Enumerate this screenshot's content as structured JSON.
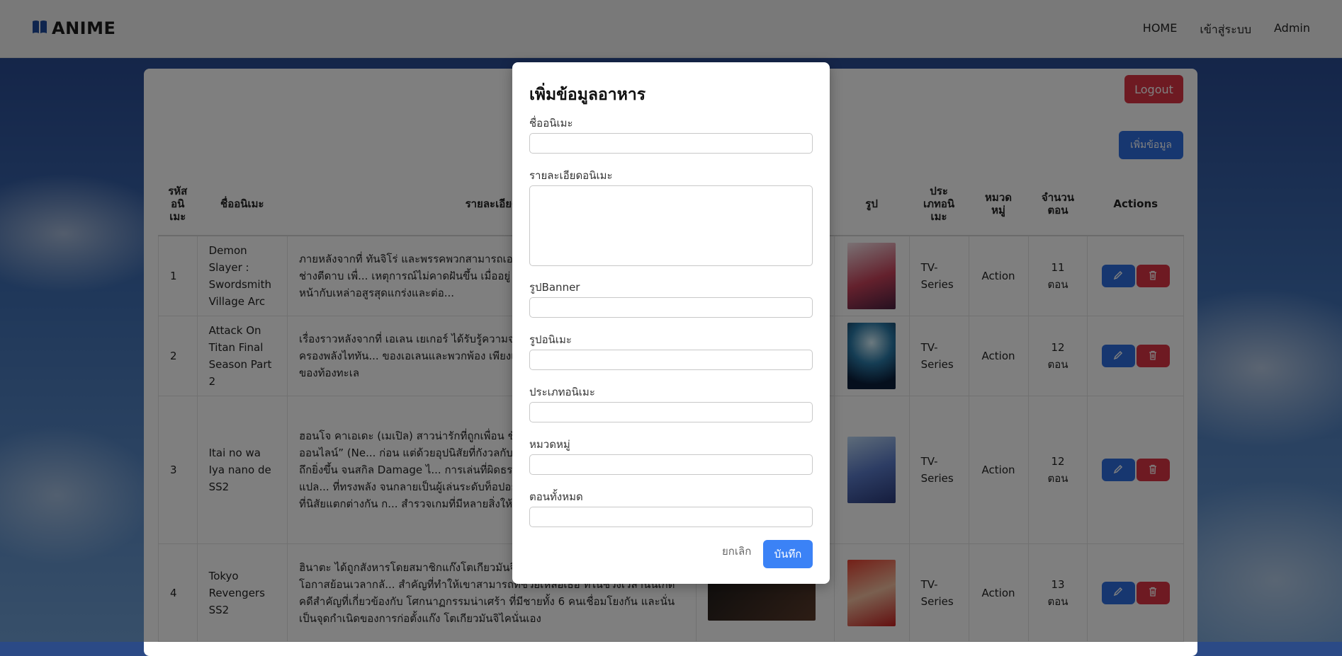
{
  "nav": {
    "brand": "ANIME",
    "brand_icon": "book-icon",
    "links": [
      "HOME",
      "เข้าสู่ระบบ",
      "Admin"
    ]
  },
  "panel": {
    "logout_label": "Logout",
    "add_label": "เพิ่มข้อมูล"
  },
  "table": {
    "headers": [
      "รหัสอนิเมะ",
      "ชื่ออนิเมะ",
      "รายละเอียด",
      "รูป",
      "ประเภทอนิเมะ",
      "หมวดหมู่",
      "จำนวนตอน",
      "Actions"
    ],
    "header_lines": {
      "id": [
        "รหัส",
        "อนิ",
        "เมะ"
      ],
      "type": [
        "ประ",
        "เภทอนิ",
        "เมะ"
      ],
      "category": [
        "หมวด",
        "หมู่"
      ],
      "episodes": [
        "จำนวน",
        "ตอน"
      ]
    },
    "rows": [
      {
        "id": "1",
        "name": "Demon Slayer : Swordsmith Village Arc",
        "desc": "ภายหลังจากที่ ทันจิโร่ และพรรคพวกสามารถเอ... รับภารกิจให้เดินทางไปยังหมู่บ้านช่างตีดาบ เพื่... เหตุการณ์ไม่คาดฝันขึ้น เมื่ออยู่ ๆ ก็มีอสูรปริศน... จึงต้องเข้าเผชิญหน้ากับเหล่าอสูรสุดแกร่งและต่อ...",
        "type": "TV-Series",
        "category": "Action",
        "episodes": "11 ตอน"
      },
      {
        "id": "2",
        "name": "Attack On Titan Final Season Part 2",
        "desc": "เรื่องราวหลังจากที่ เอเลน เยเกอร์ ได้รับรู้ความจ... รวมถึงเรื่องราวของราชวงศ์ที่ถือครองพลังไททัน... ของเอเลนและพวกพ้อง เพียงแต่ครั้งนี้จะไม่ใช่ก... ที่อยู่อีกฟากฝั่งของท้องทะเล",
        "type": "TV-Series",
        "category": "Action",
        "episodes": "12 ตอน"
      },
      {
        "id": "3",
        "name": "Itai no wa Iya nano de SS2",
        "desc": "ฮอนโจ คาเอเดะ (เมเปิล) สาวน่ารักที่ถูกเพื่อน ชั... เสมือนจริง VRMMO “นิวเวิร์ลด์ออนไลน์” (Ne... ก่อน แต่ด้วยอุปนิสัยที่กังวลกับการโดนโจมตี ไม... ค่า VIT เพื่อให้ถึกยิ่งขึ้น จนสกิล Damage ไ... การเล่นที่ผิดธรรมดากว่าคนทั่วไป ทำให้ได้สกิลแปล... ที่ทรงพลัง จนกลายเป็นผู้เล่นระดับท็อปอย่างรวด... ผู้ดูแลเกม เธอยังได้เพื่อนฝูงที่นิสัยแตกต่างกัน ก... สำรวจเกมที่มีหลายสิ่งให้ค้นหา",
        "type": "TV-Series",
        "category": "Action",
        "episodes": "12 ตอน"
      },
      {
        "id": "4",
        "name": "Tokyo Revengers SS2",
        "desc": "ฮินาตะ ได้ถูกสังหารโดยสมาชิกแก๊งโตเกียวมันจิ... เกะมิจิ และนั่นทำให้เขาได้มีโอกาสย้อนเวลากลั... สำคัญที่ทำให้เขาสามารถที่ช่วยเหลือเธอ ที่ในช่วงเวลานั้นเกิดคดีสำคัญที่เกี่ยวข้องกับ โศกนาฏกรรมน่าเศร้า ที่มีชายทั้ง 6 คนเชื่อมโยงกัน และนั่นเป็นจุดกำเนิดของการก่อตั้งแก๊ง โตเกียวมันจิไคนั่นเอง",
        "type": "TV-Series",
        "category": "Action",
        "episodes": "13 ตอน"
      }
    ]
  },
  "modal": {
    "title": "เพิ่มข้อมูลอาหาร",
    "fields": [
      {
        "label": "ชื่ออนิเมะ",
        "value": "",
        "placeholder": ""
      },
      {
        "label": "รายละเอียดอนิเมะ",
        "value": "",
        "placeholder": ""
      },
      {
        "label": "รูปBanner",
        "value": "",
        "placeholder": ""
      },
      {
        "label": "รูปอนิเมะ",
        "value": "",
        "placeholder": ""
      },
      {
        "label": "ประเภทอนิเมะ",
        "value": "",
        "placeholder": ""
      },
      {
        "label": "หมวดหมู่",
        "value": "",
        "placeholder": ""
      },
      {
        "label": "ตอนทั้งหมด",
        "value": "",
        "placeholder": ""
      }
    ],
    "cancel_label": "ยกเลิก",
    "save_label": "บันทึก"
  },
  "colors": {
    "primary": "#2f6fe0",
    "danger": "#dc3545",
    "save": "#3b82f6"
  }
}
